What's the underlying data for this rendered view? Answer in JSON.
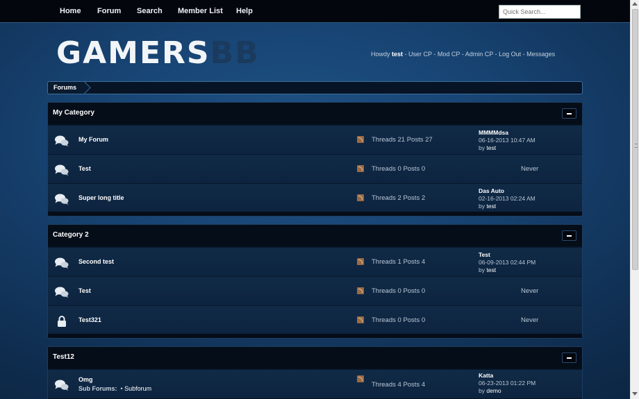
{
  "nav": {
    "home": "Home",
    "forum": "Forum",
    "search": "Search",
    "members": "Member List",
    "help": "Help"
  },
  "quick_search": {
    "placeholder": "Quick Search..."
  },
  "logo": {
    "part1": "GAMERS",
    "part2": "BB"
  },
  "welcome": {
    "howdy": "Howdy",
    "user": "test",
    "user_cp": "User CP",
    "mod_cp": "Mod CP",
    "admin_cp": "Admin CP",
    "logout": "Log Out",
    "messages": "Messages",
    "sep": " - "
  },
  "breadcrumb": {
    "item": "Forums"
  },
  "stats_labels": {
    "threads": "Threads",
    "posts": "Posts"
  },
  "categories": [
    {
      "title": "My Category",
      "forums": [
        {
          "name": "My Forum",
          "icon": "speech-bubbles-icon",
          "threads": "21",
          "posts": "27",
          "last": {
            "title": "MMMMdsa",
            "date": "06-16-2013 10:47 AM",
            "by": "by",
            "author": "test"
          }
        },
        {
          "name": "Test",
          "icon": "speech-bubbles-icon",
          "threads": "0",
          "posts": "0",
          "never": "Never"
        },
        {
          "name": "Super long title",
          "icon": "speech-bubbles-icon",
          "threads": "2",
          "posts": "2",
          "last": {
            "title": "Das Auto",
            "date": "02-16-2013 02:24 AM",
            "by": "by",
            "author": "test"
          }
        }
      ]
    },
    {
      "title": "Category 2",
      "forums": [
        {
          "name": "Second test",
          "icon": "speech-bubbles-icon",
          "threads": "1",
          "posts": "4",
          "last": {
            "title": "Test",
            "date": "06-09-2013 02:44 PM",
            "by": "by",
            "author": "test"
          }
        },
        {
          "name": "Test",
          "icon": "speech-bubbles-icon",
          "threads": "0",
          "posts": "0",
          "never": "Never"
        },
        {
          "name": "Test321",
          "icon": "lock-icon",
          "threads": "0",
          "posts": "0",
          "never": "Never"
        }
      ]
    },
    {
      "title": "Test12",
      "forums": [
        {
          "name": "Omg",
          "icon": "speech-bubbles-icon",
          "threads": "4",
          "posts": "4",
          "subforums_label": "Sub Forums:",
          "subforum": "Subforum",
          "last": {
            "title": "Katta",
            "date": "06-23-2013 01:22 PM",
            "by": "by",
            "author": "demo"
          }
        }
      ]
    }
  ]
}
